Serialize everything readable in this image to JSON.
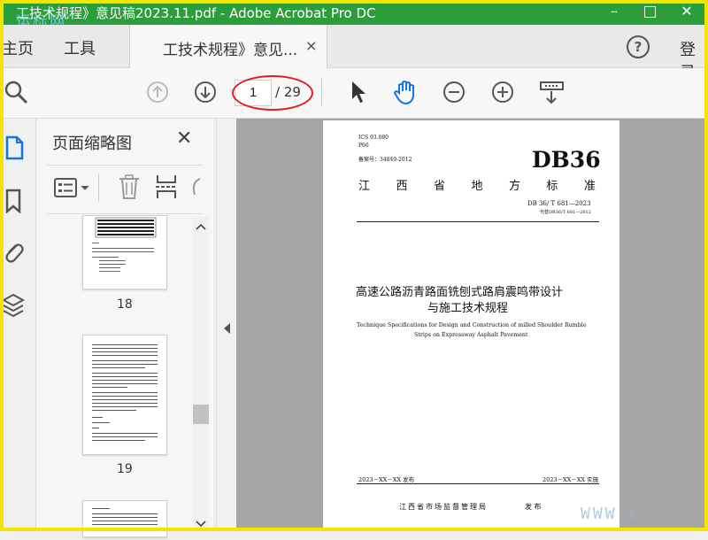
{
  "window": {
    "title": "工技术规程》意见稿2023.11.pdf - Adobe Acrobat Pro DC",
    "watermark": "运标网",
    "minimize": "–",
    "close": "✕"
  },
  "tabs": {
    "home": "主页",
    "tools": "工具",
    "document": "工技术规程》意见...",
    "close": "×",
    "help": "?",
    "login": "登录"
  },
  "toolbar": {
    "current_page": "1",
    "total_pages": "/ 29"
  },
  "thumbnails": {
    "title": "页面缩略图",
    "close": "✕",
    "pages": [
      "18",
      "19"
    ]
  },
  "document": {
    "ics": "ICS 93.080",
    "p": "P66",
    "record": "备案号：34849-2012",
    "code": "DB36",
    "region": [
      "江",
      "西",
      "省",
      "地",
      "方",
      "标",
      "准"
    ],
    "std_no": "DB 36/ T 681—2023",
    "replaces": "代替DB36/T 681—2012",
    "title_cn_1": "高速公路沥青路面铣刨式路肩震鸣带设计",
    "title_cn_2": "与施工技术规程",
    "title_en_1": "Technique Specifications for Design and Construction of milled Shoulder Rumble",
    "title_en_2": "Strips on Expressway Asphalt Pavement",
    "publish_date": "2023－XX－XX 发布",
    "implement_date": "2023－XX－XX 实施",
    "issuer": "江西省市场监督管理局",
    "issue": "发 布",
    "site_watermark": "WWW.C"
  }
}
